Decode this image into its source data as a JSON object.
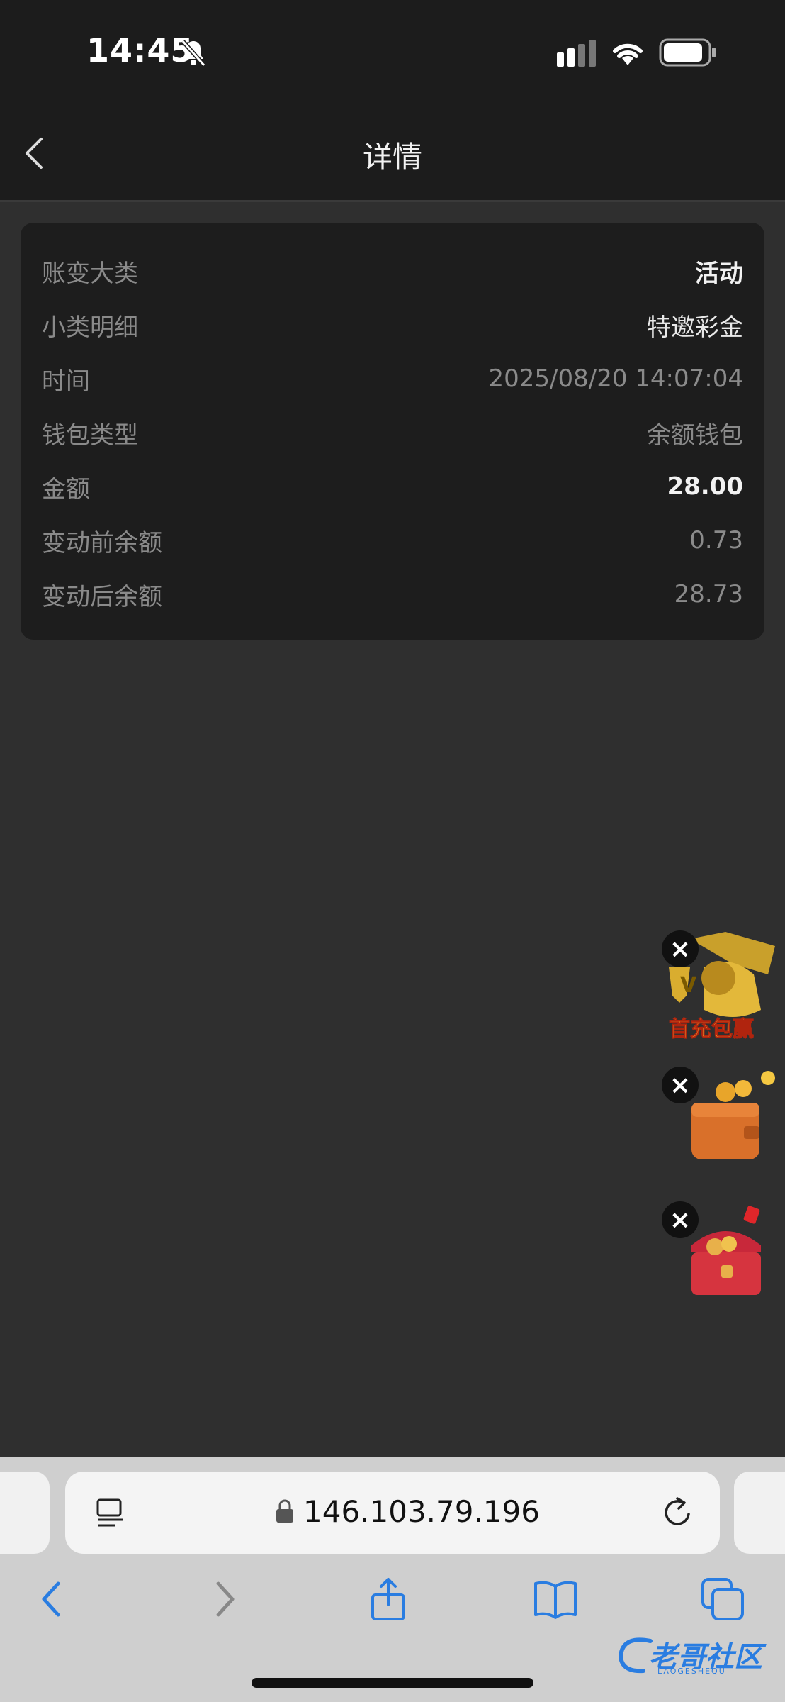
{
  "status_bar": {
    "time": "14:45",
    "icons": [
      "bell-slash-icon",
      "cellular-signal-icon",
      "wifi-icon",
      "battery-icon"
    ]
  },
  "nav": {
    "title": "详情",
    "back_icon": "chevron-left-icon"
  },
  "details": [
    {
      "label": "账变大类",
      "value": "活动"
    },
    {
      "label": "小类明细",
      "value": "特邀彩金"
    },
    {
      "label": "时间",
      "value": "2025/08/20 14:07:04"
    },
    {
      "label": "钱包类型",
      "value": "余额钱包"
    },
    {
      "label": "金额",
      "value": "28.00"
    },
    {
      "label": "变动前余额",
      "value": "0.73"
    },
    {
      "label": "变动后余额",
      "value": "28.73"
    }
  ],
  "floating_promos": [
    {
      "name": "首充包赢",
      "icon": "golden-lion-icon"
    },
    {
      "name": "",
      "icon": "wallet-coins-icon"
    },
    {
      "name": "",
      "icon": "treasure-chest-icon"
    }
  ],
  "browser": {
    "url": "146.103.79.196",
    "toolbar": [
      "back-icon",
      "forward-icon",
      "share-icon",
      "bookmarks-icon",
      "tabs-icon"
    ]
  },
  "watermark": {
    "text": "老哥社区",
    "subtext": "LAOGESHEQU"
  }
}
